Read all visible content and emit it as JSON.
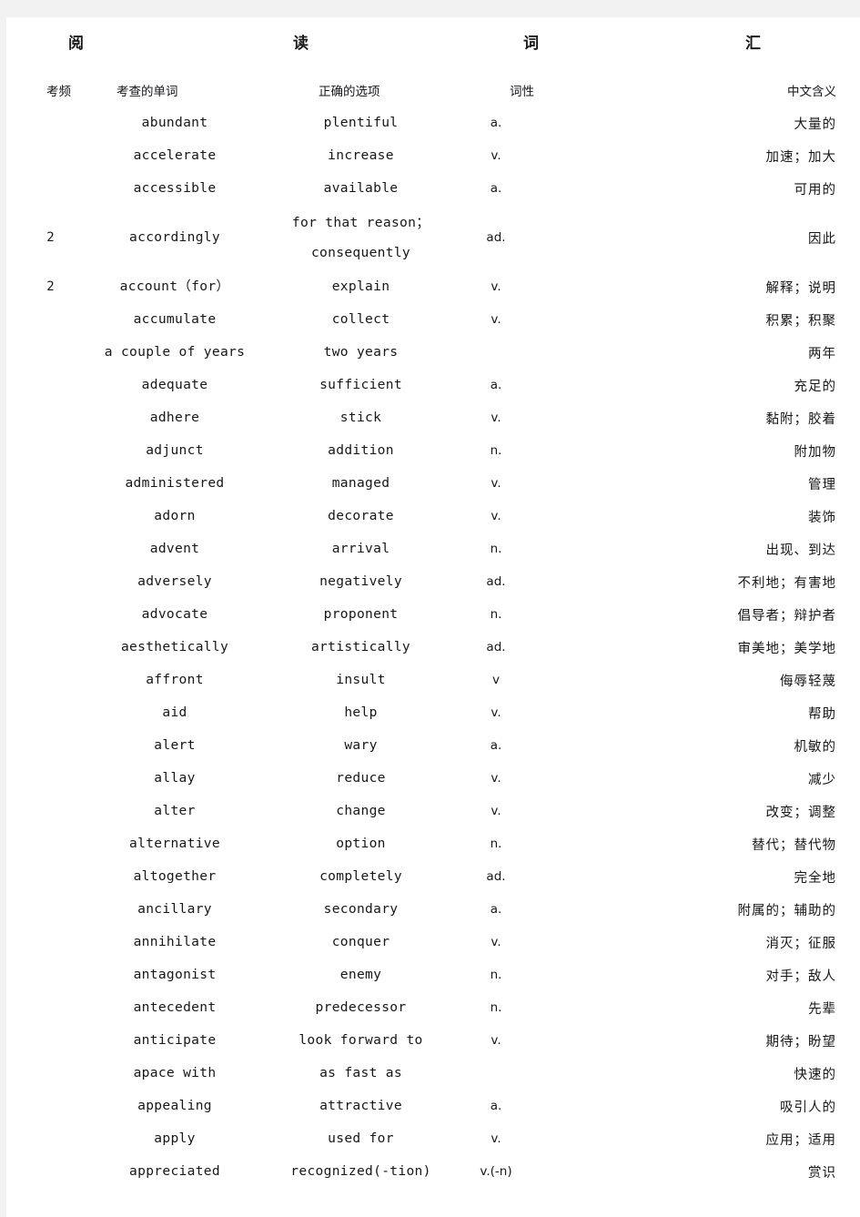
{
  "document": {
    "title_chars": [
      "阅",
      "读",
      "词",
      "汇"
    ],
    "title_text": "阅读词汇"
  },
  "table": {
    "headers": {
      "frequency": "考频",
      "word": "考查的单词",
      "option": "正确的选项",
      "pos": "词性",
      "meaning": "中文含义"
    },
    "rows": [
      {
        "freq": "",
        "word": "abundant",
        "option": "plentiful",
        "pos": "a.",
        "meaning": "大量的"
      },
      {
        "freq": "",
        "word": "accelerate",
        "option": "increase",
        "pos": "v.",
        "meaning": "加速；加大"
      },
      {
        "freq": "",
        "word": "accessible",
        "option": "available",
        "pos": "a.",
        "meaning": "可用的"
      },
      {
        "freq": "2",
        "word": "accordingly",
        "option": "for that reason；consequently",
        "pos": "ad.",
        "meaning": "因此",
        "tall": true
      },
      {
        "freq": "2",
        "word": "account（for）",
        "option": "explain",
        "pos": "v.",
        "meaning": "解释；说明"
      },
      {
        "freq": "",
        "word": "accumulate",
        "option": "collect",
        "pos": "v.",
        "meaning": "积累；积聚"
      },
      {
        "freq": "",
        "word": "a couple of years",
        "option": "two years",
        "pos": "",
        "meaning": "两年"
      },
      {
        "freq": "",
        "word": "adequate",
        "option": "sufficient",
        "pos": "a.",
        "meaning": "充足的"
      },
      {
        "freq": "",
        "word": "adhere",
        "option": "stick",
        "pos": "v.",
        "meaning": "黏附；胶着"
      },
      {
        "freq": "",
        "word": "adjunct",
        "option": "addition",
        "pos": "n.",
        "meaning": "附加物"
      },
      {
        "freq": "",
        "word": "administered",
        "option": "managed",
        "pos": "v.",
        "meaning": "管理"
      },
      {
        "freq": "",
        "word": "adorn",
        "option": "decorate",
        "pos": "v.",
        "meaning": "装饰"
      },
      {
        "freq": "",
        "word": "advent",
        "option": "arrival",
        "pos": "n.",
        "meaning": "出现、到达"
      },
      {
        "freq": "",
        "word": "adversely",
        "option": "negatively",
        "pos": "ad.",
        "meaning": "不利地；有害地"
      },
      {
        "freq": "",
        "word": "advocate",
        "option": "proponent",
        "pos": "n.",
        "meaning": "倡导者；辩护者"
      },
      {
        "freq": "",
        "word": "aesthetically",
        "option": "artistically",
        "pos": "ad.",
        "meaning": "审美地；美学地"
      },
      {
        "freq": "",
        "word": "affront",
        "option": "insult",
        "pos": "v",
        "meaning": "侮辱轻蔑"
      },
      {
        "freq": "",
        "word": "aid",
        "option": "help",
        "pos": "v.",
        "meaning": "帮助"
      },
      {
        "freq": "",
        "word": "alert",
        "option": "wary",
        "pos": "a.",
        "meaning": "机敏的"
      },
      {
        "freq": "",
        "word": "allay",
        "option": "reduce",
        "pos": "v.",
        "meaning": "减少"
      },
      {
        "freq": "",
        "word": "alter",
        "option": "change",
        "pos": "v.",
        "meaning": "改变；调整"
      },
      {
        "freq": "",
        "word": "alternative",
        "option": "option",
        "pos": "n.",
        "meaning": "替代；替代物"
      },
      {
        "freq": "",
        "word": "altogether",
        "option": "completely",
        "pos": "ad.",
        "meaning": "完全地"
      },
      {
        "freq": "",
        "word": "ancillary",
        "option": "secondary",
        "pos": "a.",
        "meaning": "附属的；辅助的"
      },
      {
        "freq": "",
        "word": "annihilate",
        "option": "conquer",
        "pos": "v.",
        "meaning": "消灭；征服"
      },
      {
        "freq": "",
        "word": "antagonist",
        "option": "enemy",
        "pos": "n.",
        "meaning": "对手；敌人"
      },
      {
        "freq": "",
        "word": "antecedent",
        "option": "predecessor",
        "pos": "n.",
        "meaning": "先辈"
      },
      {
        "freq": "",
        "word": "anticipate",
        "option": "look forward to",
        "pos": "v.",
        "meaning": "期待；盼望"
      },
      {
        "freq": "",
        "word": "apace with",
        "option": "as fast as",
        "pos": "",
        "meaning": "快速的"
      },
      {
        "freq": "",
        "word": "appealing",
        "option": "attractive",
        "pos": "a.",
        "meaning": "吸引人的"
      },
      {
        "freq": "",
        "word": "apply",
        "option": "used for",
        "pos": "v.",
        "meaning": "应用；适用"
      },
      {
        "freq": "",
        "word": "appreciated",
        "option": "recognized(-tion)",
        "pos": "v.(-n)",
        "meaning": "赏识"
      }
    ]
  }
}
